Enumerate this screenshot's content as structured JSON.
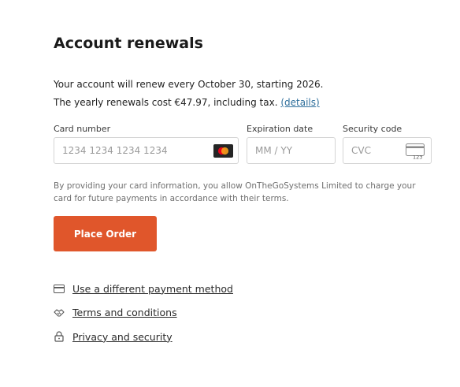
{
  "header": {
    "title": "Account renewals"
  },
  "renewal": {
    "line1": "Your account will renew every October 30, starting 2026.",
    "line2": "The yearly renewals cost €47.97, including tax.",
    "details_link": "(details)"
  },
  "form": {
    "card_number_label": "Card number",
    "card_number_placeholder": "1234 1234 1234 1234",
    "expiration_label": "Expiration date",
    "expiration_placeholder": "MM / YY",
    "security_label": "Security code",
    "security_placeholder": "CVC",
    "cvc_icon_text": "123"
  },
  "notice": "By providing your card information, you allow OnTheGoSystems Limited to charge your card for future payments in accordance with their terms.",
  "actions": {
    "place_order": "Place Order"
  },
  "links": [
    {
      "label": "Use a different payment method",
      "icon": "credit-card-icon"
    },
    {
      "label": "Terms and conditions",
      "icon": "handshake-icon"
    },
    {
      "label": "Privacy and security",
      "icon": "lock-icon"
    }
  ],
  "colors": {
    "accent": "#e0562b",
    "link": "#2f6f9c"
  }
}
